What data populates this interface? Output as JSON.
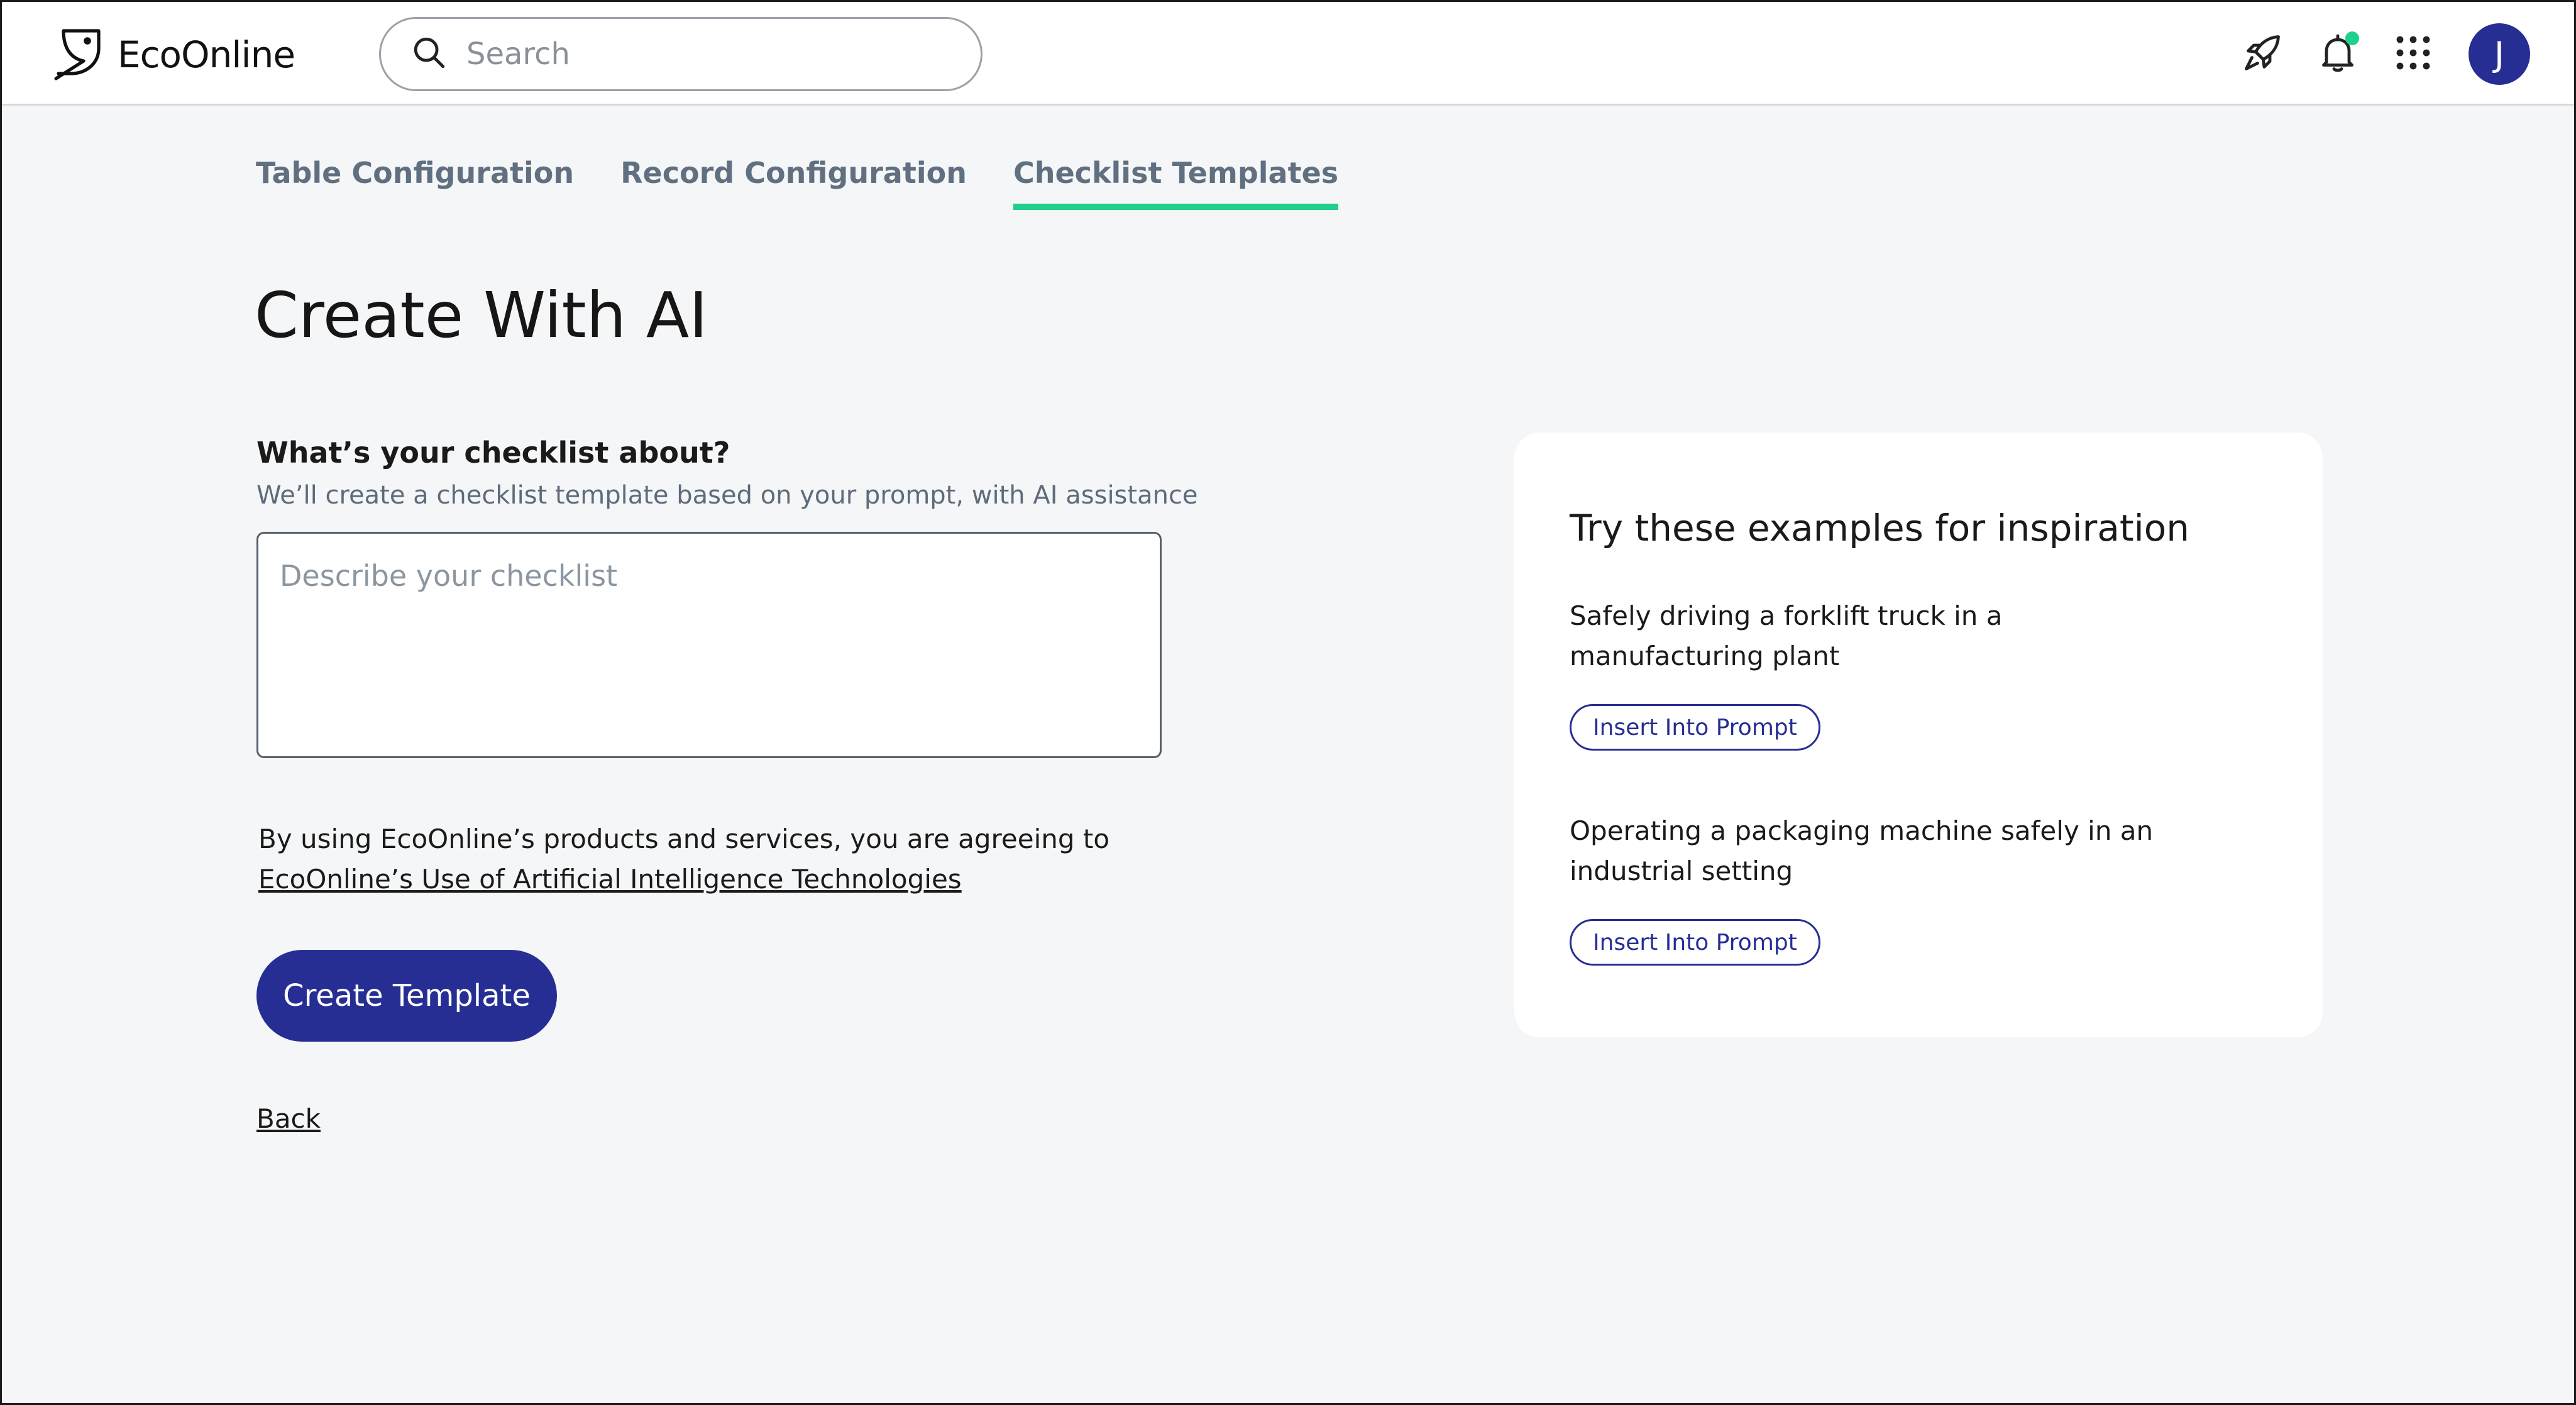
{
  "header": {
    "brand": "EcoOnline",
    "search_placeholder": "Search",
    "avatar_initial": "J",
    "accent_color": "#262e94",
    "notification_dot_color": "#1ed18c"
  },
  "tabs": [
    {
      "label": "Table Configuration",
      "active": false
    },
    {
      "label": "Record Configuration",
      "active": false
    },
    {
      "label": "Checklist Templates",
      "active": true
    }
  ],
  "main": {
    "title": "Create With AI",
    "question_label": "What’s your checklist about?",
    "question_help": "We’ll create a checklist template based on your prompt, with AI assistance",
    "prompt_placeholder": "Describe your checklist",
    "terms_text": "By using EcoOnline’s products and services, you are agreeing to",
    "terms_link": "EcoOnline’s Use of Artificial Intelligence Technologies",
    "create_button": "Create Template",
    "back_link": "Back"
  },
  "inspiration": {
    "title": "Try these examples for inspiration",
    "examples": [
      {
        "text": "Safely driving a forklift truck in a manufacturing plant",
        "button": "Insert Into Prompt"
      },
      {
        "text": "Operating a packaging machine safely in an industrial setting",
        "button": "Insert Into Prompt"
      }
    ]
  },
  "icons": {
    "logo": "bird-logo-icon",
    "search": "search-icon",
    "rocket": "rocket-icon",
    "bell": "bell-icon",
    "apps": "apps-grid-icon"
  }
}
